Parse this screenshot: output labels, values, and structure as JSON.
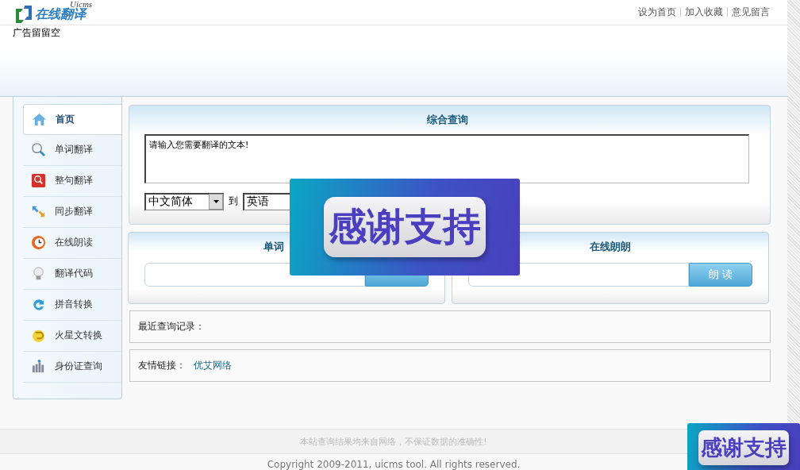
{
  "header": {
    "logo_text": "在线翻译",
    "logo_sub": "Uicms",
    "links": [
      "设为首页",
      "加入收藏",
      "意见留言"
    ]
  },
  "ad_text": "广告留留空",
  "sidebar": {
    "items": [
      {
        "label": "首页",
        "selected": true
      },
      {
        "label": "单词翻译",
        "selected": false
      },
      {
        "label": "整句翻译",
        "selected": false
      },
      {
        "label": "同步翻译",
        "selected": false
      },
      {
        "label": "在线朗读",
        "selected": false
      },
      {
        "label": "翻译代码",
        "selected": false
      },
      {
        "label": "拼音转换",
        "selected": false
      },
      {
        "label": "火星文转换",
        "selected": false
      },
      {
        "label": "身份证查询",
        "selected": false
      }
    ]
  },
  "general_query": {
    "title": "综合查询",
    "text": "请输入您需要翻译的文本!",
    "from_language": "中文简体",
    "to_word": "到",
    "to_language": "英语"
  },
  "word_query": {
    "title": "单词"
  },
  "read_aloud": {
    "title": "在线朗朗",
    "button": "朗 读"
  },
  "recent": {
    "label": "最近查询记录："
  },
  "friend_links": {
    "label": "友情链接：",
    "links": [
      "优艾网络"
    ]
  },
  "footer": {
    "notice": "本站查询结果均来自网络，不保证数据的准确性!",
    "copyright": "Copyright 2009-2011, uicms tool. All rights reserved."
  },
  "floating_banner": {
    "text": "感谢支持"
  },
  "corner_banner": {
    "text": "感谢支持"
  }
}
